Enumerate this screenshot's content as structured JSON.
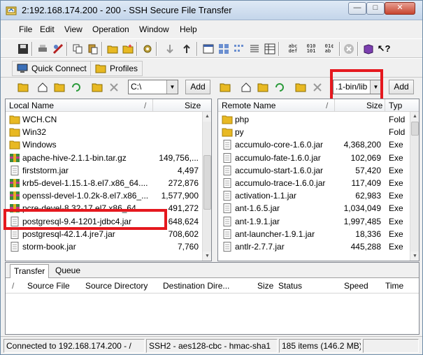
{
  "window": {
    "title": "2:192.168.174.200 - 200 - SSH Secure File Transfer"
  },
  "menu": [
    "File",
    "Edit",
    "View",
    "Operation",
    "Window",
    "Help"
  ],
  "quick_connect": {
    "label": "Quick Connect"
  },
  "profiles": {
    "label": "Profiles"
  },
  "local": {
    "path": "C:\\",
    "add_label": "Add",
    "columns": {
      "name": "Local Name",
      "size": "Size"
    },
    "files": [
      {
        "name": "WCH.CN",
        "size": "",
        "kind": "folder"
      },
      {
        "name": "Win32",
        "size": "",
        "kind": "folder"
      },
      {
        "name": "Windows",
        "size": "",
        "kind": "folder"
      },
      {
        "name": "apache-hive-2.1.1-bin.tar.gz",
        "size": "149,756,...",
        "kind": "archive"
      },
      {
        "name": "firststorm.jar",
        "size": "4,497",
        "kind": "file"
      },
      {
        "name": "krb5-devel-1.15.1-8.el7.x86_64....",
        "size": "272,876",
        "kind": "archive"
      },
      {
        "name": "openssl-devel-1.0.2k-8.el7.x86_...",
        "size": "1,577,900",
        "kind": "archive"
      },
      {
        "name": "pcre-devel-8.32-17.el7.x86_64....",
        "size": "491,272",
        "kind": "archive"
      },
      {
        "name": "postgresql-9.4-1201-jdbc4.jar",
        "size": "648,624",
        "kind": "file"
      },
      {
        "name": "postgresql-42.1.4.jre7.jar",
        "size": "708,602",
        "kind": "file"
      },
      {
        "name": "storm-book.jar",
        "size": "7,760",
        "kind": "file"
      }
    ]
  },
  "remote": {
    "path": ".1-bin/lib",
    "add_label": "Add",
    "columns": {
      "name": "Remote Name",
      "size": "Size",
      "type": "Typ"
    },
    "files": [
      {
        "name": "php",
        "size": "",
        "type": "Fold",
        "kind": "folder"
      },
      {
        "name": "py",
        "size": "",
        "type": "Fold",
        "kind": "folder"
      },
      {
        "name": "accumulo-core-1.6.0.jar",
        "size": "4,368,200",
        "type": "Exe",
        "kind": "file"
      },
      {
        "name": "accumulo-fate-1.6.0.jar",
        "size": "102,069",
        "type": "Exe",
        "kind": "file"
      },
      {
        "name": "accumulo-start-1.6.0.jar",
        "size": "57,420",
        "type": "Exe",
        "kind": "file"
      },
      {
        "name": "accumulo-trace-1.6.0.jar",
        "size": "117,409",
        "type": "Exe",
        "kind": "file"
      },
      {
        "name": "activation-1.1.jar",
        "size": "62,983",
        "type": "Exe",
        "kind": "file"
      },
      {
        "name": "ant-1.6.5.jar",
        "size": "1,034,049",
        "type": "Exe",
        "kind": "file"
      },
      {
        "name": "ant-1.9.1.jar",
        "size": "1,997,485",
        "type": "Exe",
        "kind": "file"
      },
      {
        "name": "ant-launcher-1.9.1.jar",
        "size": "18,336",
        "type": "Exe",
        "kind": "file"
      },
      {
        "name": "antlr-2.7.7.jar",
        "size": "445,288",
        "type": "Exe",
        "kind": "file"
      }
    ]
  },
  "transfer": {
    "tabs": [
      "Transfer",
      "Queue"
    ],
    "columns": [
      "Source File",
      "Source Directory",
      "Destination Dire...",
      "Size",
      "Status",
      "Speed",
      "Time"
    ]
  },
  "status": {
    "connection": "Connected to 192.168.174.200 - /",
    "cipher": "SSH2 - aes128-cbc - hmac-sha1",
    "items": "185 items (146.2 MB)"
  },
  "colors": {
    "highlight": "#e5181e",
    "folder": "#e8b923"
  }
}
